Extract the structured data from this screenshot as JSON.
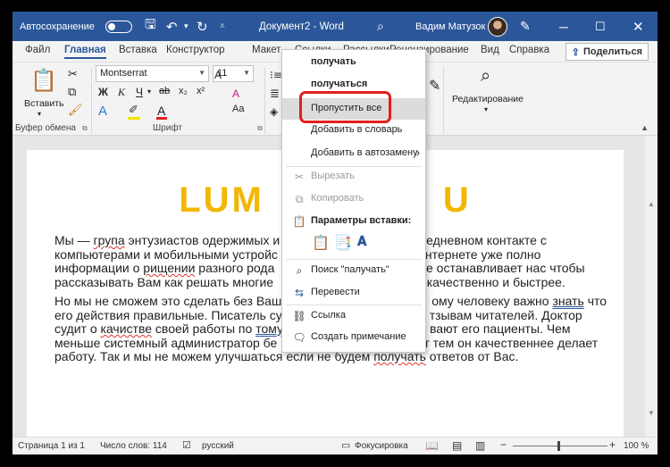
{
  "titlebar": {
    "autosave_label": "Автосохранение",
    "doc_title": "Документ2 - Word",
    "user_name": "Вадим Матузок",
    "icons": [
      "save-icon",
      "undo-icon",
      "redo-icon",
      "search-icon",
      "pen-icon",
      "minimize-icon",
      "maximize-icon",
      "close-icon"
    ]
  },
  "tabs": [
    "Файл",
    "Главная",
    "Вставка",
    "Конструктор",
    "Макет",
    "Ссылки",
    "Рассылки",
    "Рецензирование",
    "Вид",
    "Справка"
  ],
  "share_label": "Поделиться",
  "ribbon": {
    "paste_label": "Вставить",
    "clipboard_group": "Буфер обмена",
    "font_group": "Шрифт",
    "font_name": "Montserrat",
    "font_size": "11",
    "bold": "Ж",
    "italic": "К",
    "underline": "Ч",
    "editing_label": "Редактирование"
  },
  "document": {
    "title_visible": "LUM",
    "title_visible_end": "U",
    "p1_parts": [
      "Мы — ",
      "група",
      " энтузиастов одержимых и",
      "едневном контакте с",
      "компьютерами и мобильными устройс",
      "нтернете уже полно",
      "информации о ",
      "рищении",
      " разного рода",
      " не останавливает нас чтобы",
      "рассказывать Вам как решать многие",
      "е качественно и быстрее."
    ],
    "p2_parts": [
      "Но мы не сможем это сделать без Ваш",
      "ому человеку важно ",
      "знать",
      " что",
      "его действия правильные. Писатель су",
      "тзывам читателей. Доктор",
      "судит о ",
      "качистве",
      " своей работы по ",
      "тому",
      "вают его пациенты. Чем",
      "меньше системный администратор бе",
      "т тем он качественнее делает",
      "работу. Так и мы не можем улучшаться если не будем ",
      "получать",
      " ответов от Вас."
    ]
  },
  "context_menu": {
    "suggestions": [
      "получать",
      "получаться"
    ],
    "skip_all": "Пропустить все",
    "add_to_dict": "Добавить в словарь",
    "add_autocorrect": "Добавить в автозамену",
    "cut": "Вырезать",
    "copy": "Копировать",
    "paste_options": "Параметры вставки:",
    "search": "Поиск \"палучать\"",
    "translate": "Перевести",
    "link": "Ссылка",
    "comment": "Создать примечание"
  },
  "statusbar": {
    "page": "Страница 1 из 1",
    "words": "Число слов: 114",
    "language": "русский",
    "focus": "Фокусировка",
    "zoom": "100 %"
  },
  "colors": {
    "title_bar": "#2b579a",
    "doc_heading": "#f2b705",
    "highlight_box": "#e0201a"
  }
}
